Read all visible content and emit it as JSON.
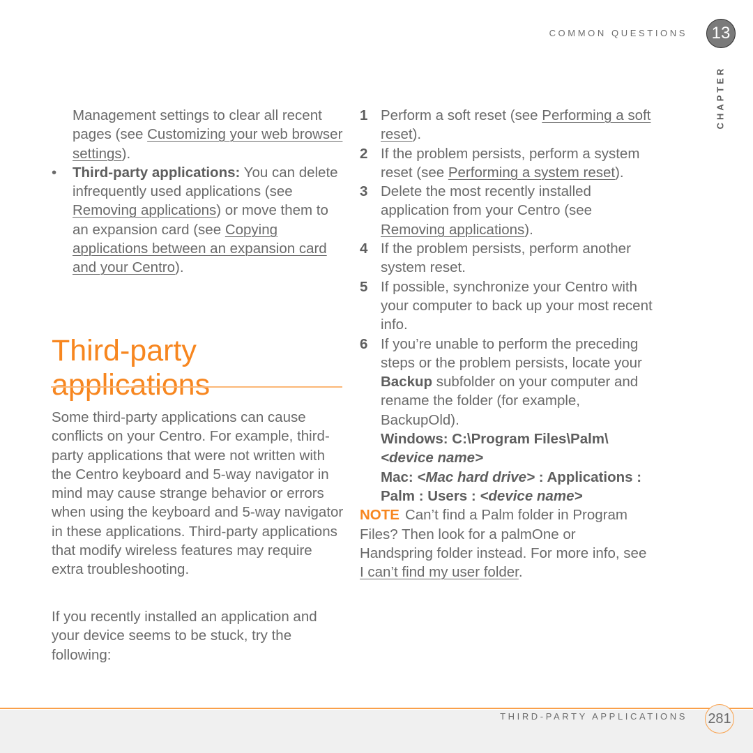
{
  "header": {
    "running_head": "COMMON QUESTIONS",
    "chapter_number": "13",
    "chapter_label": "CHAPTER"
  },
  "left_column": {
    "continued": {
      "before": "Management settings to clear all recent pages (see ",
      "link": "Customizing your web browser settings",
      "after": ")."
    },
    "bullet": {
      "marker": "•",
      "bold": "Third-party applications:",
      "text1": " You can delete infrequently used applications (see ",
      "link1": "Removing applications",
      "text2": ") or move them to an expansion card (see ",
      "link2": "Copying applications between an expansion card and your Centro",
      "text3": ")."
    },
    "heading": "Third-party applications",
    "paragraph1": "Some third-party applications can cause conflicts on your Centro. For example, third-party applications that were not written with the Centro keyboard and 5-way navigator in mind may cause strange behavior or errors when using the keyboard and 5-way navigator in these applications. Third-party applications that modify wireless features may require extra troubleshooting.",
    "paragraph2": "If you recently installed an application and your device seems to be stuck, try the following:"
  },
  "right_column": {
    "steps": [
      {
        "num": "1",
        "before": "Perform a soft reset (see ",
        "link": "Performing a soft reset",
        "after": ")."
      },
      {
        "num": "2",
        "before": "If the problem persists, perform a system reset (see ",
        "link": "Performing a system reset",
        "after": ")."
      },
      {
        "num": "3",
        "before": "Delete the most recently installed application from your Centro (see ",
        "link": "Removing applications",
        "after": ")."
      },
      {
        "num": "4",
        "text": "If the problem persists, perform another system reset."
      },
      {
        "num": "5",
        "text": "If possible, synchronize your Centro with your computer to back up your most recent info."
      },
      {
        "num": "6",
        "before": "If you’re unable to perform the preceding steps or the problem persists, locate your ",
        "bold": "Backup",
        "after": " subfolder on your computer and rename the folder (for example, BackupOld)."
      }
    ],
    "windows_path": {
      "prefix": "Windows: C:\\Program Files\\Palm\\",
      "italic": "<device name>"
    },
    "mac_path": {
      "prefix": "Mac: ",
      "italic1": "<Mac hard drive>",
      "middle": " : Applications : Palm : Users : ",
      "italic2": "<device name>"
    },
    "note": {
      "label": "NOTE",
      "before": "Can’t find a Palm folder in Program Files? Then look for a palmOne or Handspring folder instead. For more info, see ",
      "link": "I can’t find my user folder",
      "after": "."
    }
  },
  "footer": {
    "title": "THIRD-PARTY APPLICATIONS",
    "page_number": "281"
  },
  "colors": {
    "accent": "#f7861f",
    "text": "#6a6a6a",
    "footer_bg": "#f0f0f0"
  }
}
